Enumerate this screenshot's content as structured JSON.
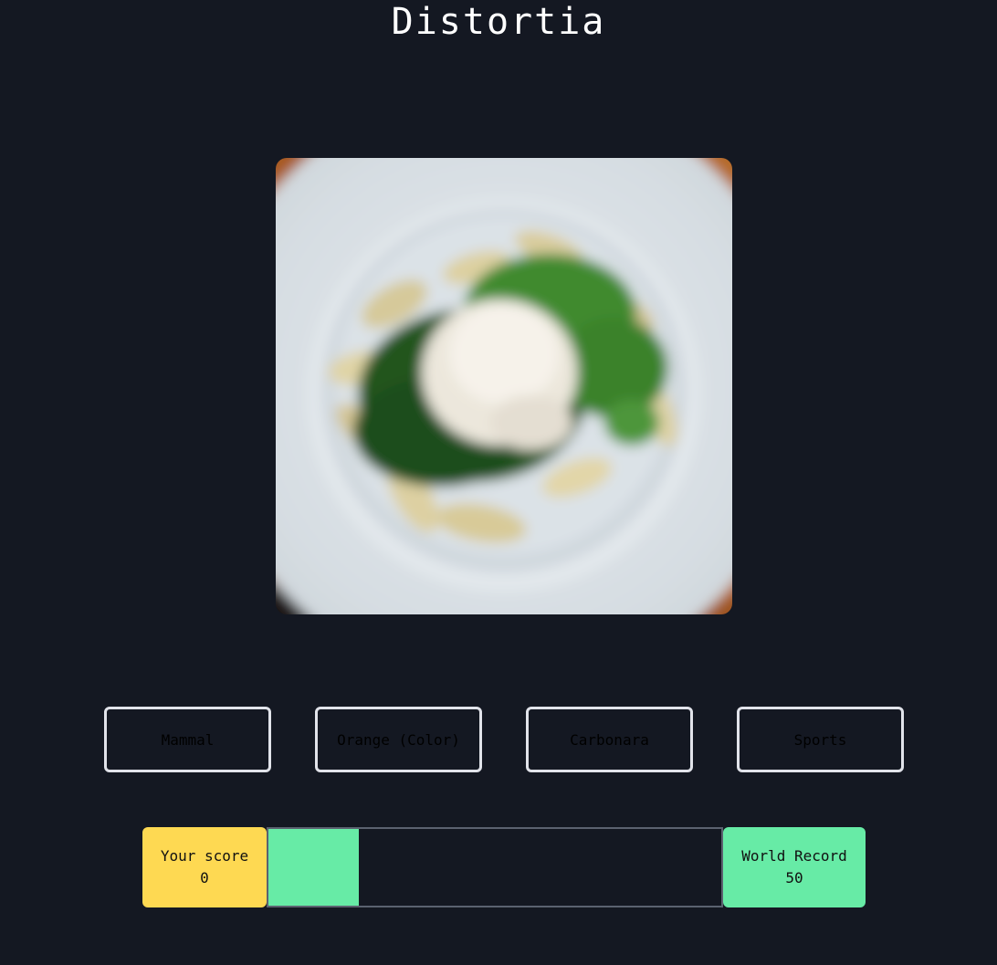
{
  "app": {
    "title": "Distortia"
  },
  "image": {
    "subject": "pasta-with-peas-and-cheese",
    "blurred": true
  },
  "options": [
    {
      "label": "Mammal"
    },
    {
      "label": "Orange (Color)"
    },
    {
      "label": "Carbonara"
    },
    {
      "label": "Sports"
    }
  ],
  "score": {
    "label": "Your score",
    "value": "0"
  },
  "record": {
    "label": "World Record",
    "value": "50"
  },
  "timer": {
    "remaining_fraction": 0.2
  },
  "colors": {
    "background": "#141822",
    "score_yellow": "#fed952",
    "accent_green": "#67eba6",
    "button_border": "#e1e3ea"
  }
}
